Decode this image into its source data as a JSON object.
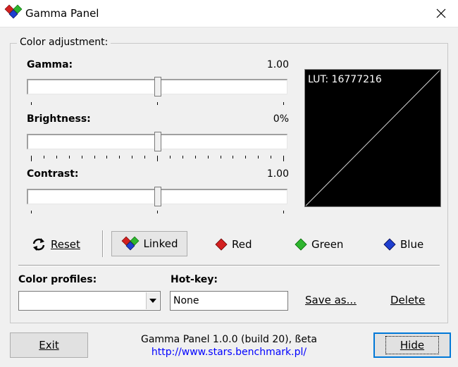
{
  "window": {
    "title": "Gamma Panel"
  },
  "group": {
    "title": "Color adjustment:"
  },
  "sliders": {
    "gamma": {
      "label": "Gamma:",
      "value": "1.00",
      "position": 0.5
    },
    "brightness": {
      "label": "Brightness:",
      "value": "0%",
      "position": 0.5
    },
    "contrast": {
      "label": "Contrast:",
      "value": "1.00",
      "position": 0.5
    }
  },
  "lut": {
    "text": "LUT: 16777216"
  },
  "channels": {
    "reset": "Reset",
    "linked": "Linked",
    "red": "Red",
    "green": "Green",
    "blue": "Blue"
  },
  "profiles": {
    "label": "Color profiles:",
    "selected": ""
  },
  "hotkey": {
    "label": "Hot-key:",
    "value": "None"
  },
  "actions": {
    "save_as": "Save as...",
    "delete": "Delete"
  },
  "footer": {
    "exit": "Exit",
    "hide": "Hide",
    "version": "Gamma Panel 1.0.0 (build 20), ßeta",
    "url": "http://www.stars.benchmark.pl/"
  },
  "colors": {
    "red": "#d32020",
    "green": "#2fb52f",
    "blue": "#1f3fcf",
    "link": "#0000ff"
  }
}
